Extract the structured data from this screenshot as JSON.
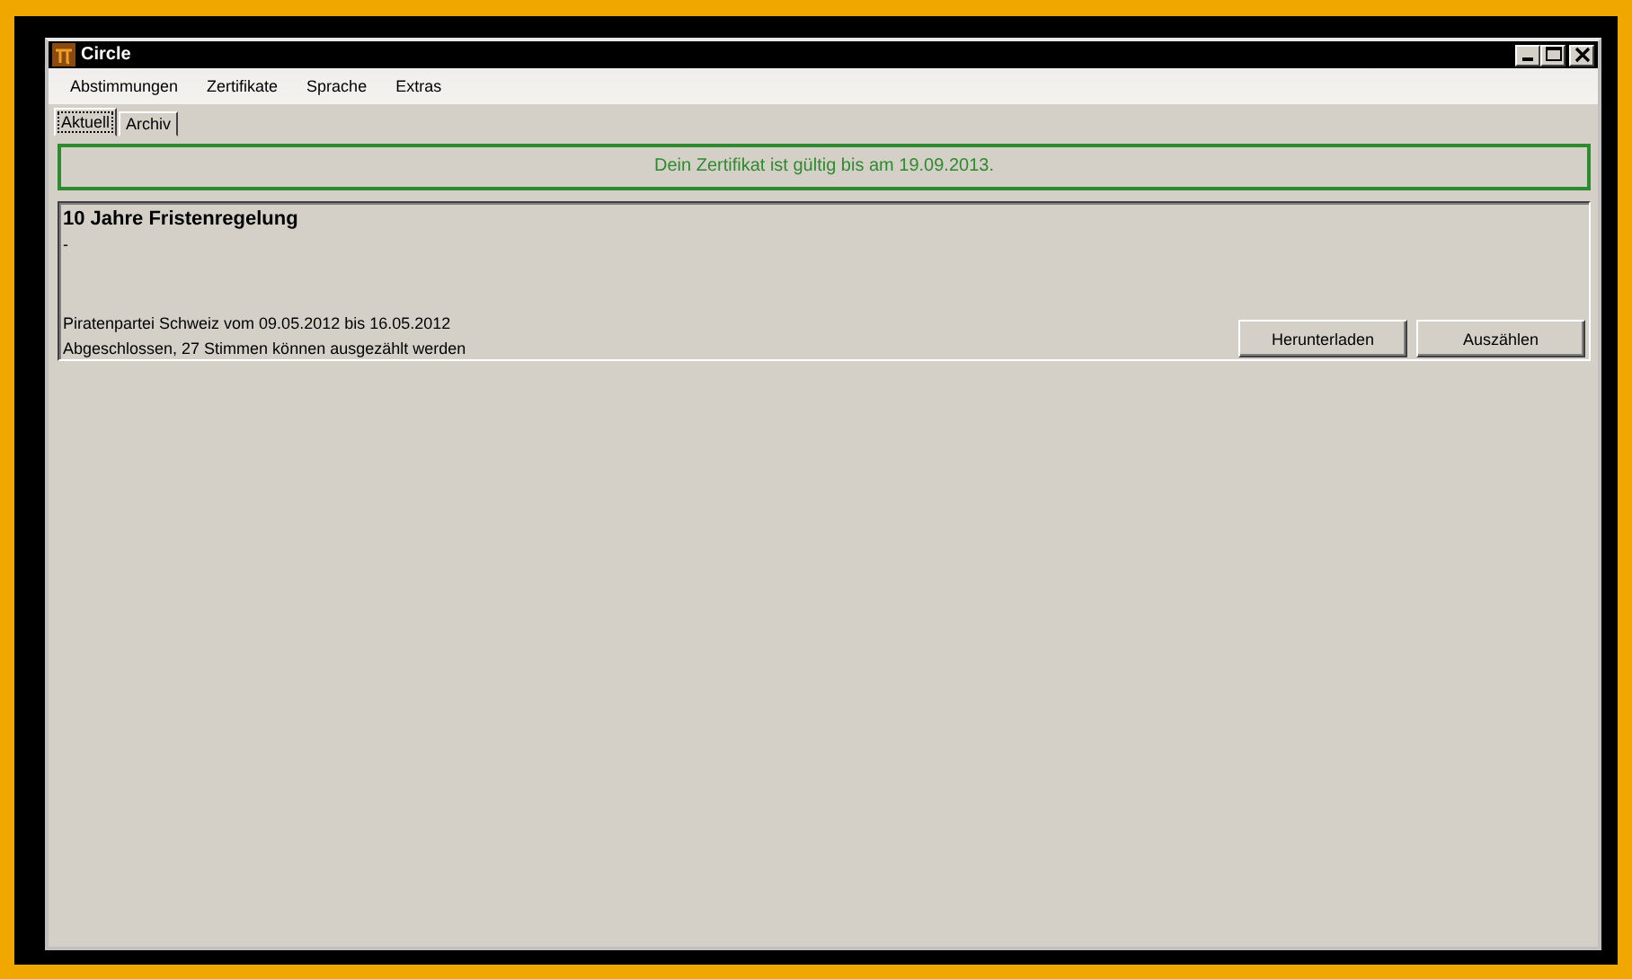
{
  "window": {
    "title": "Circle"
  },
  "menu": [
    "Abstimmungen",
    "Zertifikate",
    "Sprache",
    "Extras"
  ],
  "tabs": [
    {
      "label": "Aktuell",
      "selected": true
    },
    {
      "label": "Archiv",
      "selected": false
    }
  ],
  "certificate_notice": "Dein Zertifikat ist gültig bis am 19.09.2013.",
  "votes": [
    {
      "title": "10 Jahre Fristenregelung",
      "description": "-",
      "organizer": "Piratenpartei Schweiz vom 09.05.2012 bis 16.05.2012",
      "status": "Abgeschlossen, 27 Stimmen können ausgezählt werden",
      "buttons": [
        "Herunterladen",
        "Auszählen"
      ]
    }
  ]
}
